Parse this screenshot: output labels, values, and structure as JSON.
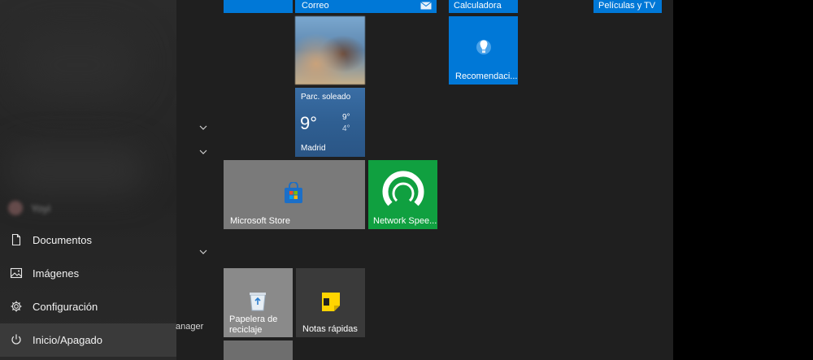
{
  "left_menu": {
    "user_name": "Yoyi",
    "items": [
      {
        "label": "Documentos",
        "icon": "document-icon"
      },
      {
        "label": "Imágenes",
        "icon": "image-icon"
      },
      {
        "label": "Configuración",
        "icon": "gear-icon"
      },
      {
        "label": "Inicio/Apagado",
        "icon": "power-icon"
      }
    ],
    "cutoff_text": "anager"
  },
  "tiles": {
    "correo": {
      "label": "Correo",
      "icon": "mail-icon"
    },
    "calculadora": {
      "label": "Calculadora"
    },
    "peliculas": {
      "label": "Películas y TV"
    },
    "recomendaciones": {
      "label": "Recomendaci...",
      "icon": "lightbulb-icon"
    },
    "weather": {
      "condition": "Parc. soleado",
      "temp": "9°",
      "high": "9°",
      "low": "4°",
      "city": "Madrid"
    },
    "store": {
      "label": "Microsoft Store",
      "icon": "store-icon"
    },
    "network": {
      "label": "Network Spee...",
      "icon": "speed-gauge-icon"
    },
    "recycle": {
      "label_line1": "Papelera de",
      "label_line2": "reciclaje",
      "icon": "recycle-bin-icon"
    },
    "notes": {
      "label": "Notas rápidas",
      "icon": "sticky-note-icon"
    }
  },
  "colors": {
    "accent_blue": "#0078d7",
    "green": "#10a040",
    "background": "#1f1f1f"
  }
}
